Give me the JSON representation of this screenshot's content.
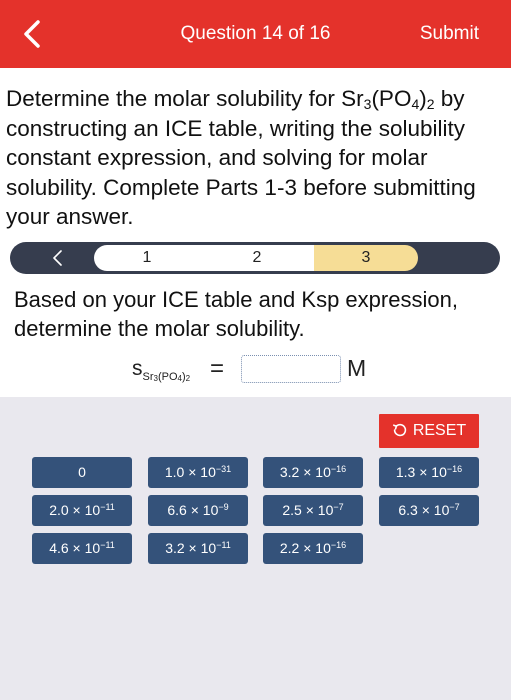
{
  "header": {
    "title": "Question 14 of 16",
    "submit_label": "Submit",
    "background": "#e4322b"
  },
  "question": {
    "text_before": "Determine the molar solubility for Sr",
    "sub1": "3",
    "paren_open": "(PO",
    "sub2": "4",
    "paren_close": ")",
    "sub3": "2",
    "text_after": " by constructing an ICE table, writing the solubility constant expression, and solving for molar solubility. Complete Parts 1-3 before submitting your answer."
  },
  "stepper": {
    "steps": [
      {
        "label": "1"
      },
      {
        "label": "2"
      },
      {
        "label": "3",
        "active": true
      }
    ],
    "active_color": "#f6dd96"
  },
  "part3": {
    "prompt": "Based on your ICE table and Ksp expression, determine the molar solubility.",
    "formula_s": "s",
    "formula_sub": "Sr",
    "formula_sub_3": "3",
    "formula_sub_po": "(PO",
    "formula_sub_4": "4",
    "formula_sub_close": ")",
    "formula_sub_2": "2",
    "equals": "=",
    "answer_value": "",
    "unit": "M"
  },
  "tray": {
    "reset_label": "RESET",
    "tiles": [
      {
        "mant": "0",
        "exp": ""
      },
      {
        "mant": "1.0 × 10",
        "exp": "−31"
      },
      {
        "mant": "3.2 × 10",
        "exp": "−16"
      },
      {
        "mant": "1.3 × 10",
        "exp": "−16"
      },
      {
        "mant": "2.0 × 10",
        "exp": "−11"
      },
      {
        "mant": "6.6 × 10",
        "exp": "−9"
      },
      {
        "mant": "2.5 × 10",
        "exp": "−7"
      },
      {
        "mant": "6.3 × 10",
        "exp": "−7"
      },
      {
        "mant": "4.6 × 10",
        "exp": "−11"
      },
      {
        "mant": "3.2 × 10",
        "exp": "−11"
      },
      {
        "mant": "2.2 × 10",
        "exp": "−16"
      }
    ],
    "tile_color": "#34527a"
  }
}
